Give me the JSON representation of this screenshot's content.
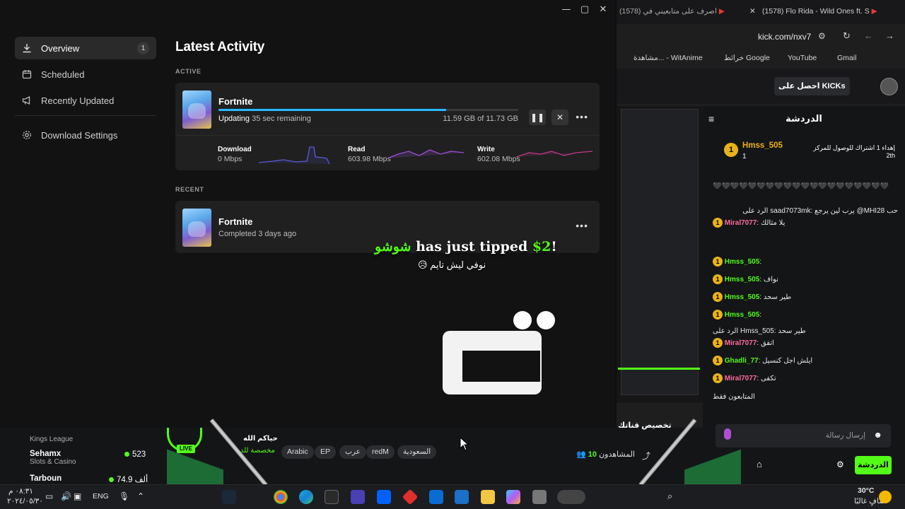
{
  "epic": {
    "window_controls": [
      "—",
      "▢",
      "✕"
    ],
    "sidebar": [
      {
        "label": "Overview",
        "badge": "1",
        "icon": "download-icon",
        "active": true
      },
      {
        "label": "Scheduled",
        "icon": "calendar-icon"
      },
      {
        "label": "Recently Updated",
        "icon": "megaphone-icon"
      },
      {
        "label": "Download Settings",
        "icon": "gear-icon"
      }
    ],
    "title": "Latest Activity",
    "active_label": "ACTIVE",
    "recent_label": "RECENT",
    "active_item": {
      "name": "Fortnite",
      "status_word": "Updating",
      "remaining": "35 sec remaining",
      "size": "11.59 GB of 11.73 GB",
      "progress_fraction": 0.76,
      "stats": [
        {
          "label": "Download",
          "value": "0 Mbps"
        },
        {
          "label": "Read",
          "value": "603.98 Mbps"
        },
        {
          "label": "Write",
          "value": "602.08 Mbps"
        }
      ]
    },
    "recent_item": {
      "name": "Fortnite",
      "status": "Completed 3 days ago"
    }
  },
  "overlay": {
    "tipper": "شوشو",
    "tip_text": " has just tipped ",
    "tip_amount": "$2",
    "tip_end": "!",
    "sub": "😥 نوفي ليش تايم"
  },
  "browser": {
    "tab1": "(1578) Flo Rida - Wild Ones ft. S",
    "tab2": "(1578) اصرف على متابعيني في",
    "url": "kick.com/nxv7",
    "bookmarks": [
      "Gmail",
      "YouTube",
      "خرائط Google",
      "مشاهدة... - WitAnime"
    ],
    "kicks_button": "احصل على KICKs",
    "chat_title": "الدردشة",
    "pinned_user": "Hmss_505",
    "pinned_count": "1",
    "pinned_text": "إهداء 1 اشتراك للوصول للمركز 2th",
    "messages": [
      {
        "user": "",
        "text": "🖤🖤🖤🖤🖤🖤🖤🖤🖤🖤🖤🖤🖤🖤🖤🖤🖤🖤🖤🖤"
      },
      {
        "user": "",
        "text": "الرد على saad7073mk: يرب لين يرجع @MHI28 حب"
      },
      {
        "user": "Miral7077",
        "text": "يلا مثالك"
      },
      {
        "user": "Hmss_505",
        "text": ""
      },
      {
        "user": "Hmss_505",
        "text": "نواف"
      },
      {
        "user": "Hmss_505",
        "text": "طير سحد"
      },
      {
        "user": "Hmss_505",
        "text": ""
      },
      {
        "user": "",
        "text": "الرد على Hmss_505: طير سحد"
      },
      {
        "user": "Miral7077",
        "text": "اتفق"
      },
      {
        "user": "Ghadli_77",
        "text": "ايلش اجل كنسيل"
      },
      {
        "user": "Miral7077",
        "text": "تكفى"
      }
    ],
    "top_supporters": "المتابعون فقط",
    "chat_placeholder": "إرسال رسالة",
    "send_label": "الدردشة"
  },
  "kick_bottom": {
    "recommended": [
      {
        "name": "Kings League",
        "category": "",
        "count": ""
      },
      {
        "name": "Sehamx",
        "category": "Slots & Casino",
        "count": "523"
      },
      {
        "name": "Tarboun",
        "category": "",
        "count": "74.9 ألف"
      }
    ],
    "live_badge": "LIVE",
    "stream_title": "حياكم الله",
    "stream_sub": "مخصصة للد",
    "tags": [
      "Arabic",
      "EP",
      "عرب",
      "redM",
      "السعودية"
    ],
    "viewers_label": "المشاهدون",
    "viewers_count": "10",
    "clip_label": "تخصيص قناتك"
  },
  "taskbar": {
    "lang": "ENG",
    "time": "٠٨:٣١ م",
    "date": "٢٠٢٤/٠٥/٣٠",
    "temp": "30°C",
    "weather": "صافٍ غالبًا"
  }
}
